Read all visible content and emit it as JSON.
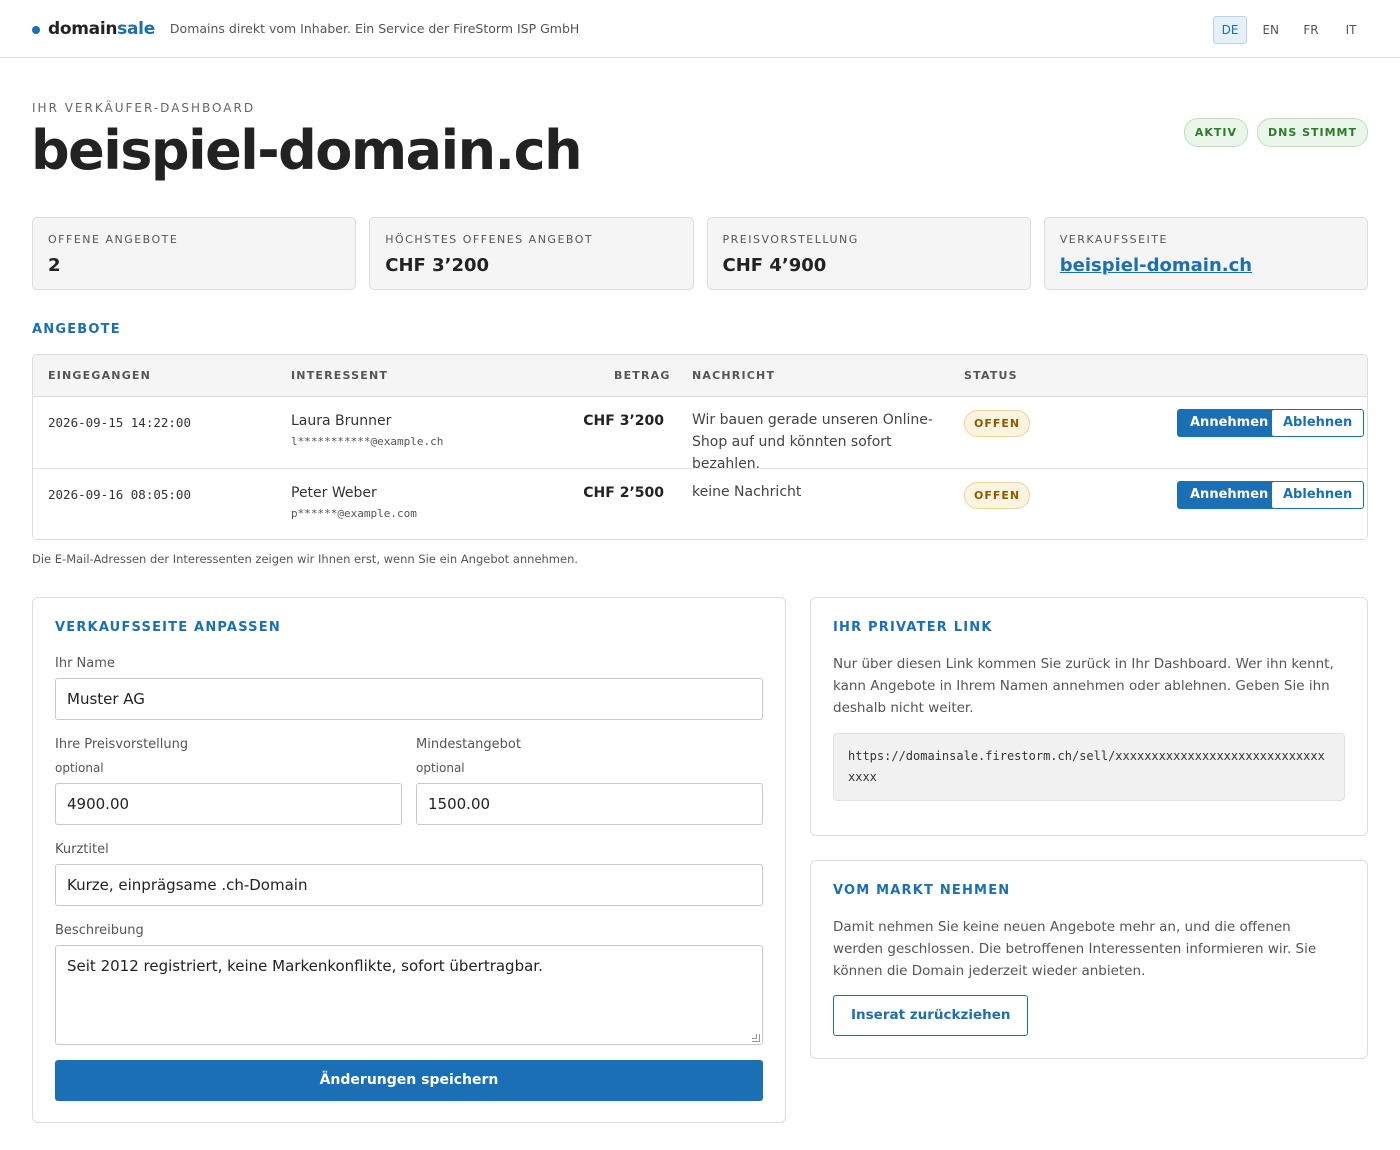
{
  "header": {
    "brand_main": "domain",
    "brand_accent": "sale",
    "tagline": "Domains direkt vom Inhaber. Ein Service der FireStorm ISP GmbH",
    "languages": [
      "DE",
      "EN",
      "FR",
      "IT"
    ],
    "active_language": "DE"
  },
  "page": {
    "kicker": "IHR VERKÄUFER-DASHBOARD",
    "domain": "beispiel-domain.ch",
    "badges": [
      "AKTIV",
      "DNS STIMMT"
    ]
  },
  "stats": [
    {
      "label": "OFFENE ANGEBOTE",
      "value": "2"
    },
    {
      "label": "HÖCHSTES OFFENES ANGEBOT",
      "value": "CHF 3’200"
    },
    {
      "label": "PREISVORSTELLUNG",
      "value": "CHF 4’900"
    },
    {
      "label": "VERKAUFSSEITE",
      "value": "beispiel-domain.ch"
    }
  ],
  "offers": {
    "heading": "ANGEBOTE",
    "columns": {
      "received": "EINGEGANGEN",
      "buyer": "INTERESSENT",
      "amount": "BETRAG",
      "message": "NACHRICHT",
      "status": "STATUS"
    },
    "rows": [
      {
        "received": "2026-09-15 14:22:00",
        "name": "Laura Brunner",
        "email": "l***********@example.ch",
        "amount": "CHF 3’200",
        "message": "Wir bauen gerade unseren Online-Shop auf und könnten sofort bezahlen.",
        "status": "OFFEN",
        "accept_label": "Annehmen",
        "reject_label": "Ablehnen"
      },
      {
        "received": "2026-09-16 08:05:00",
        "name": "Peter Weber",
        "email": "p******@example.com",
        "amount": "CHF 2’500",
        "message": "keine Nachricht",
        "status": "OFFEN",
        "accept_label": "Annehmen",
        "reject_label": "Ablehnen"
      }
    ],
    "note": "Die E-Mail-Adressen der Interessenten zeigen wir Ihnen erst, wenn Sie ein Angebot annehmen."
  },
  "edit": {
    "heading": "VERKAUFSSEITE ANPASSEN",
    "name_label": "Ihr Name",
    "name_value": "Muster AG",
    "price_label": "Ihre Preisvorstellung",
    "price_sub": "optional",
    "price_value": "4900.00",
    "min_label": "Mindestangebot",
    "min_sub": "optional",
    "min_value": "1500.00",
    "title_label": "Kurztitel",
    "title_value": "Kurze, einprägsame .ch-Domain",
    "desc_label": "Beschreibung",
    "desc_value": "Seit 2012 registriert, keine Markenkonflikte, sofort übertragbar.",
    "save_label": "Änderungen speichern"
  },
  "private_link": {
    "heading": "IHR PRIVATER LINK",
    "text": "Nur über diesen Link kommen Sie zurück in Ihr Dashboard. Wer ihn kennt, kann Angebote in Ihrem Namen annehmen oder ablehnen. Geben Sie ihn deshalb nicht weiter.",
    "url": "https://domainsale.firestorm.ch/sell/xxxxxxxxxxxxxxxxxxxxxxxxxxxxxxxxx"
  },
  "remove": {
    "heading": "VOM MARKT NEHMEN",
    "text": "Damit nehmen Sie keine neuen Angebote mehr an, und die offenen werden geschlossen. Die betroffenen Interessenten informieren wir. Sie können die Domain jederzeit wieder anbieten.",
    "button_label": "Inserat zurückziehen"
  },
  "colors": {
    "accent": "#1a6fb5",
    "success": "#2c7a2c",
    "warning": "#8a5a00"
  }
}
